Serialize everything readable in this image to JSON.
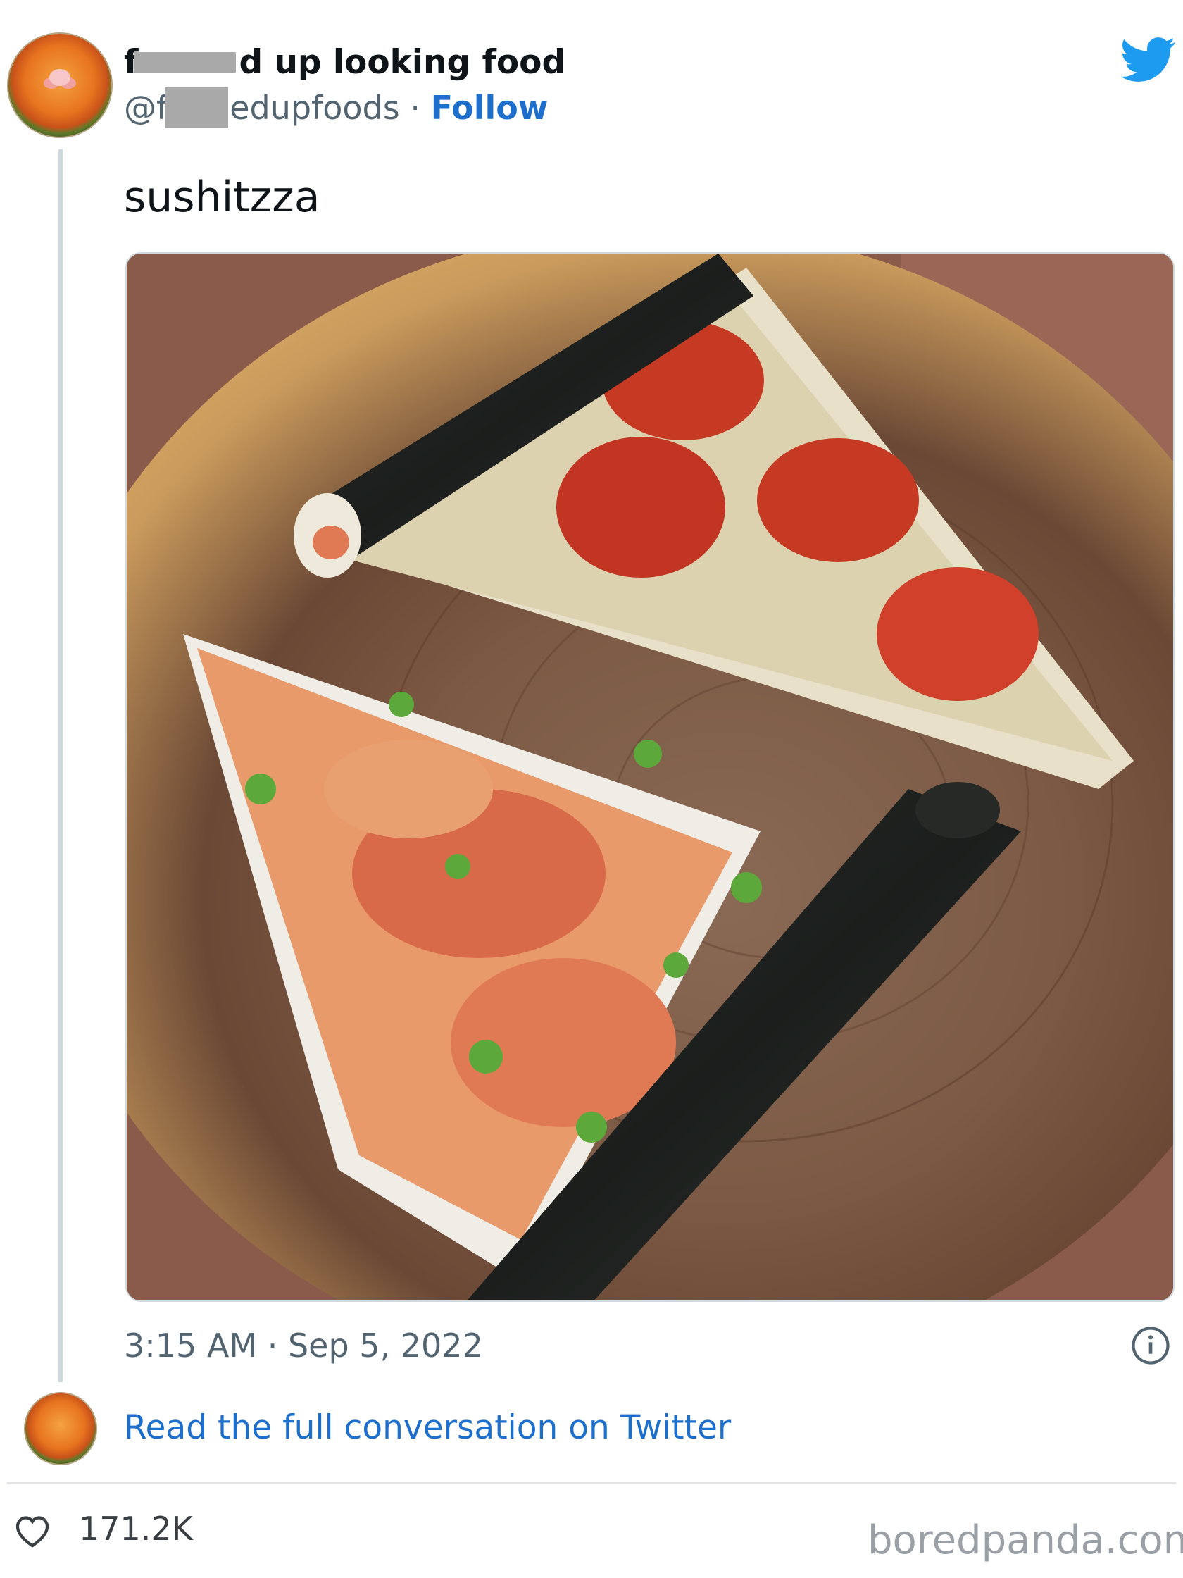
{
  "tweet": {
    "display_name_start": "f",
    "display_name_end": "d up looking food",
    "handle_start": "@f",
    "handle_end": "edupfoods",
    "separator": " · ",
    "follow_label": "Follow",
    "text": "sushitzza",
    "timestamp": "3:15 AM · Sep 5, 2022",
    "read_more": "Read the full conversation on Twitter",
    "likes": "171.2K"
  },
  "watermark": "boredpanda.com",
  "icons": {
    "brand": "twitter-bird-icon",
    "info": "info-icon",
    "like": "heart-icon"
  },
  "colors": {
    "link": "#1d6fcb",
    "twitter_blue": "#1d9bf0",
    "muted": "#536471"
  }
}
